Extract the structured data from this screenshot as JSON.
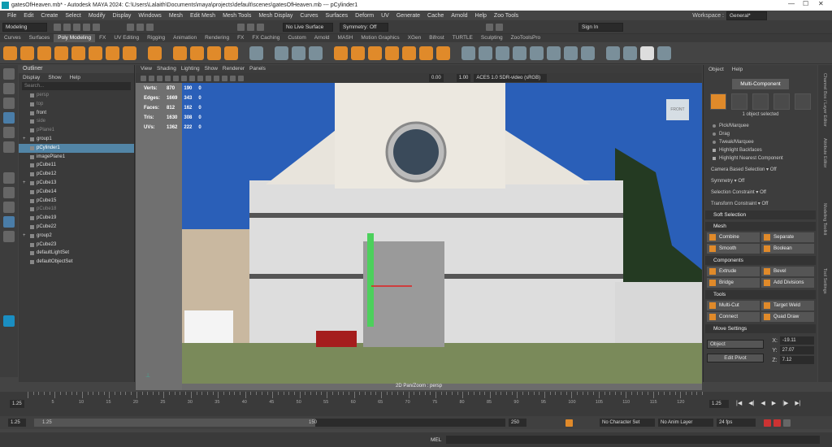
{
  "app": {
    "title": "gatesOfHeaven.mb* - Autodesk MAYA 2024: C:\\Users\\Lalaith\\Documents\\maya\\projects\\default\\scenes\\gatesOfHeaven.mb  ---  pCylinder1",
    "menus": [
      "File",
      "Edit",
      "Create",
      "Select",
      "Modify",
      "Display",
      "Windows",
      "Mesh",
      "Edit Mesh",
      "Mesh Tools",
      "Mesh Display",
      "Curves",
      "Surfaces",
      "Deform",
      "UV",
      "Generate",
      "Cache",
      "Arnold",
      "Help",
      "Zoo Tools"
    ],
    "workspace_label": "Workspace :",
    "workspace_value": "General*"
  },
  "statusline": {
    "mode": "Modeling",
    "live": "No Live Surface",
    "symmetry": "Symmetry: Off",
    "sign_in": "Sign In"
  },
  "shelf_tabs": [
    "Curves",
    "Surfaces",
    "Poly Modeling",
    "FX",
    "UV Editing",
    "Rigging",
    "Animation",
    "Rendering",
    "FX",
    "FX Caching",
    "Custom",
    "Arnold",
    "MASH",
    "Motion Graphics",
    "XGen",
    "Bifrost",
    "TURTLE",
    "Sculpting",
    "ZooToolsPro"
  ],
  "shelf_active": 2,
  "outliner": {
    "title": "Outliner",
    "menus": [
      "Display",
      "Show",
      "Help"
    ],
    "search_placeholder": "Search...",
    "items": [
      {
        "label": "persp",
        "dim": true
      },
      {
        "label": "top",
        "dim": true
      },
      {
        "label": "front",
        "dim": false
      },
      {
        "label": "side",
        "dim": true
      },
      {
        "label": "pPlane1",
        "dim": true
      },
      {
        "label": "group1",
        "dim": false,
        "plus": true
      },
      {
        "label": "pCylinder1",
        "dim": false,
        "selected": true
      },
      {
        "label": "imagePlane1",
        "dim": false
      },
      {
        "label": "pCube11",
        "dim": false
      },
      {
        "label": "pCube12",
        "dim": false
      },
      {
        "label": "pCube13",
        "dim": false,
        "plus": true
      },
      {
        "label": "pCube14",
        "dim": false
      },
      {
        "label": "pCube15",
        "dim": false
      },
      {
        "label": "pCube18",
        "dim": true
      },
      {
        "label": "pCube19",
        "dim": false
      },
      {
        "label": "pCube22",
        "dim": false
      },
      {
        "label": "group2",
        "dim": false,
        "plus": true
      },
      {
        "label": "pCube23",
        "dim": false
      },
      {
        "label": "defaultLightSet",
        "dim": false
      },
      {
        "label": "defaultObjectSet",
        "dim": false
      }
    ]
  },
  "viewport": {
    "menus": [
      "View",
      "Shading",
      "Lighting",
      "Show",
      "Renderer",
      "Panels"
    ],
    "exposure": "0.00",
    "gamma": "1.00",
    "colorspace": "ACES 1.0 SDR-video (sRGB)",
    "hud": [
      [
        "Verts:",
        "870",
        "190",
        "0"
      ],
      [
        "Edges:",
        "1669",
        "343",
        "0"
      ],
      [
        "Faces:",
        "812",
        "162",
        "0"
      ],
      [
        "Tris:",
        "1630",
        "308",
        "0"
      ],
      [
        "UVs:",
        "1362",
        "222",
        "0"
      ]
    ],
    "camera_label": "2D Pan/Zoom : persp",
    "viewcube_label": "FRONT"
  },
  "modeling": {
    "menus": [
      "Object",
      "Help"
    ],
    "mode_button": "Multi-Component",
    "selected_count": "1 object selected",
    "pick_options": [
      {
        "label": "Pick/Marquee",
        "type": "radio"
      },
      {
        "label": "Drag",
        "type": "radio"
      },
      {
        "label": "Tweak/Marquee",
        "type": "radio"
      },
      {
        "label": "Highlight Backfaces",
        "type": "check"
      },
      {
        "label": "Highlight Nearest Component",
        "type": "check"
      }
    ],
    "camera_sel": "Camera Based Selection",
    "camera_sel_val": "Off",
    "symmetry": "Symmetry",
    "symmetry_val": "Off",
    "sel_constraint": "Selection Constraint",
    "sel_constraint_val": "Off",
    "transform_constraint": "Transform Constraint",
    "transform_constraint_val": "Off",
    "soft_selection": "Soft Selection",
    "sections": [
      {
        "title": "Mesh",
        "buttons": [
          "Combine",
          "Separate",
          "Smooth",
          "Boolean"
        ]
      },
      {
        "title": "Components",
        "buttons": [
          "Extrude",
          "Bevel",
          "Bridge",
          "Add Divisions"
        ]
      },
      {
        "title": "Tools",
        "buttons": [
          "Multi-Cut",
          "Target Weld",
          "Connect",
          "Quad Draw"
        ]
      }
    ],
    "move_settings": "Move Settings",
    "object_label": "Object",
    "edit_pivot": "Edit Pivot",
    "xyz": [
      {
        "axis": "X:",
        "value": "-19.11"
      },
      {
        "axis": "Y:",
        "value": "27.07"
      },
      {
        "axis": "Z:",
        "value": "7.12"
      }
    ]
  },
  "sidebar_tabs": [
    "Channel Box / Layer Editor",
    "Attribute Editor",
    "Modeling Toolkit",
    "Tool Settings"
  ],
  "timeline": {
    "ticks": [
      "5",
      "10",
      "15",
      "20",
      "25",
      "30",
      "35",
      "40",
      "45",
      "50",
      "55",
      "60",
      "65",
      "70",
      "75",
      "80",
      "85",
      "90",
      "95",
      "100",
      "105",
      "110",
      "115",
      "120"
    ],
    "current_left": "1.25",
    "current_right": "1.25"
  },
  "range": {
    "start": "1.25",
    "inner_start": "1.25",
    "inner_end": "150",
    "end": "250",
    "char_set": "No Character Set",
    "anim_layer": "No Anim Layer",
    "fps": "24 fps"
  },
  "cmd": {
    "lang": "MEL"
  },
  "colors": {
    "accent": "#e08a2a",
    "selection": "#5285a6"
  }
}
